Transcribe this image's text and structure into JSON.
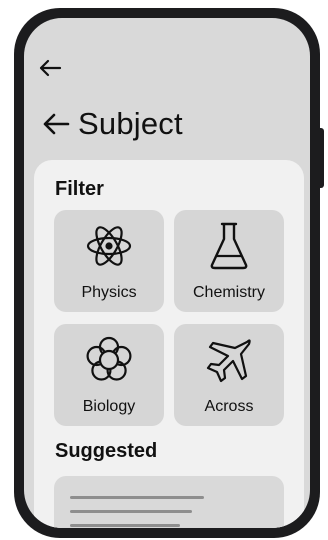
{
  "header": {
    "title": "Subject"
  },
  "filter": {
    "heading": "Filter",
    "tiles": [
      {
        "label": "Physics",
        "icon": "atom-icon"
      },
      {
        "label": "Chemistry",
        "icon": "flask-icon"
      },
      {
        "label": "Biology",
        "icon": "flower-icon"
      },
      {
        "label": "Across",
        "icon": "airplane-icon"
      }
    ]
  },
  "suggested": {
    "heading": "Suggested"
  },
  "colors": {
    "frame": "#1c1c1e",
    "screen": "#d9d9d9",
    "card": "#f1f1f1",
    "tile": "#d6d6d6",
    "text": "#111111"
  }
}
